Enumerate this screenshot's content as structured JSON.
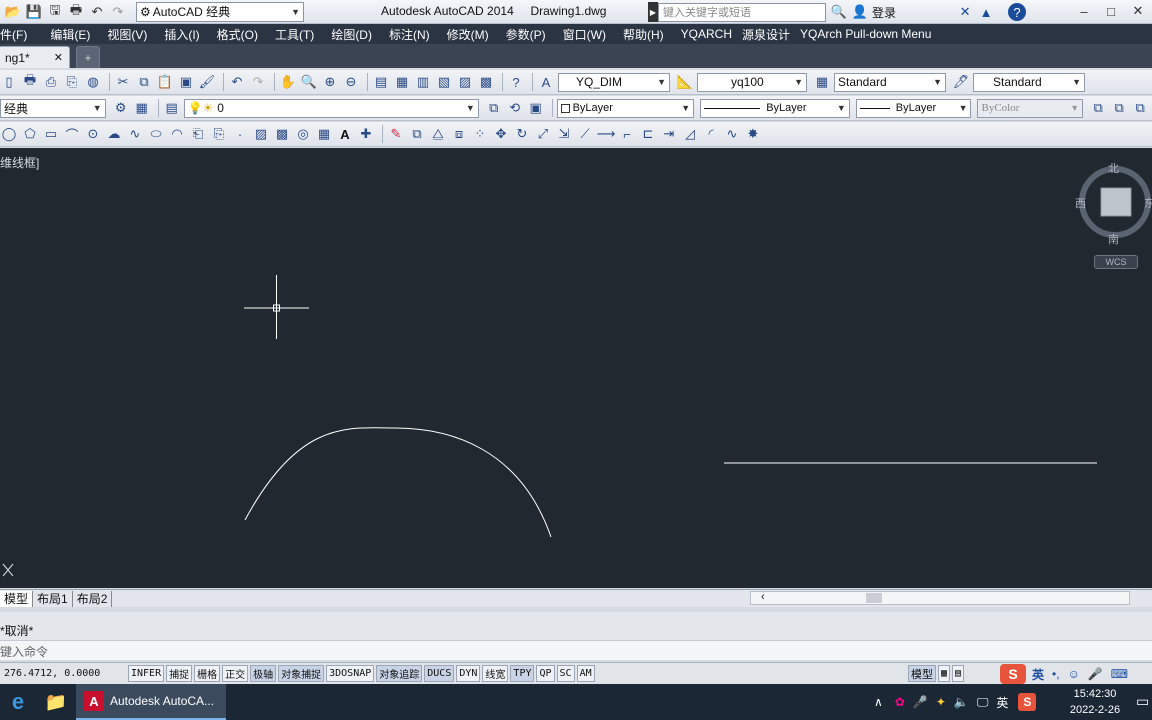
{
  "title": {
    "workspace": "AutoCAD 经典",
    "app_name": "Autodesk AutoCAD 2014",
    "document": "Drawing1.dwg",
    "search_placeholder": "键入关键字或短语",
    "login": "登录"
  },
  "menu": [
    "件(F)",
    "编辑(E)",
    "视图(V)",
    "插入(I)",
    "格式(O)",
    "工具(T)",
    "绘图(D)",
    "标注(N)",
    "修改(M)",
    "参数(P)",
    "窗口(W)",
    "帮助(H)",
    "YQARCH",
    "源泉设计",
    "YQArch Pull-down Menu"
  ],
  "doc_tab": "ng1*",
  "toolbar2": {
    "dim_style": "YQ_DIM",
    "text_style": "yq100",
    "table_style": "Standard",
    "mleader_style": "Standard"
  },
  "toolbar3": {
    "workspace": "经典",
    "layer": "0",
    "color": "ByLayer",
    "linetype": "ByLayer",
    "lineweight": "ByLayer",
    "plotstyle": "ByColor"
  },
  "viewport": {
    "label": "维线框]",
    "viewcube": {
      "north": "北",
      "south": "南",
      "west": "西",
      "east": "东",
      "wcs": "WCS"
    }
  },
  "layout_tabs": [
    "模型",
    "布局1",
    "布局2"
  ],
  "command": {
    "history": "*取消*",
    "prompt": "键入命令"
  },
  "status": {
    "coords": "276.4712, 0.0000",
    "toggles": [
      {
        "label": "INFER",
        "on": false
      },
      {
        "label": "捕捉",
        "on": false
      },
      {
        "label": "栅格",
        "on": false
      },
      {
        "label": "正交",
        "on": false
      },
      {
        "label": "极轴",
        "on": true
      },
      {
        "label": "对象捕捉",
        "on": true
      },
      {
        "label": "3DOSNAP",
        "on": false
      },
      {
        "label": "对象追踪",
        "on": true
      },
      {
        "label": "DUCS",
        "on": true
      },
      {
        "label": "DYN",
        "on": false
      },
      {
        "label": "线宽",
        "on": false
      },
      {
        "label": "TPY",
        "on": true
      },
      {
        "label": "QP",
        "on": false
      },
      {
        "label": "SC",
        "on": false
      },
      {
        "label": "AM",
        "on": false
      }
    ],
    "model": "模型",
    "ime": "英"
  },
  "taskbar": {
    "active_app": "Autodesk AutoCA...",
    "ime": "英",
    "time": "15:42:30",
    "date": "2022-2-26"
  },
  "colors": {
    "canvas": "#212830",
    "menubar": "#2b3443",
    "taskbar": "#1c2736",
    "status_on": "#c8d3e6"
  }
}
